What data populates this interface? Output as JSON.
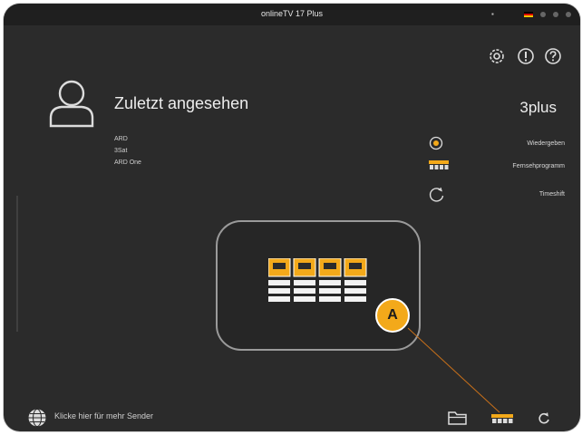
{
  "window": {
    "title": "onlineTV 17 Plus"
  },
  "header": {
    "section_title": "Zuletzt angesehen",
    "current_channel": "3plus"
  },
  "recent_channels": [
    "ARD",
    "3Sat",
    "ARD One"
  ],
  "actions": [
    {
      "label": "Wiedergeben",
      "icon": "play-icon"
    },
    {
      "label": "Fernsehprogramm",
      "icon": "tv-guide-icon"
    },
    {
      "label": "Timeshift",
      "icon": "timeshift-icon"
    }
  ],
  "callout": {
    "badge": "A"
  },
  "footer": {
    "more_channels": "Klicke hier für mehr Sender"
  },
  "colors": {
    "background": "#2b2b2b",
    "accent": "#f3a91a",
    "text": "#ededed"
  },
  "icons": [
    "settings-icon",
    "info-icon",
    "help-icon",
    "user-avatar-icon",
    "globe-icon",
    "folder-icon",
    "tv-guide-icon",
    "refresh-icon"
  ]
}
